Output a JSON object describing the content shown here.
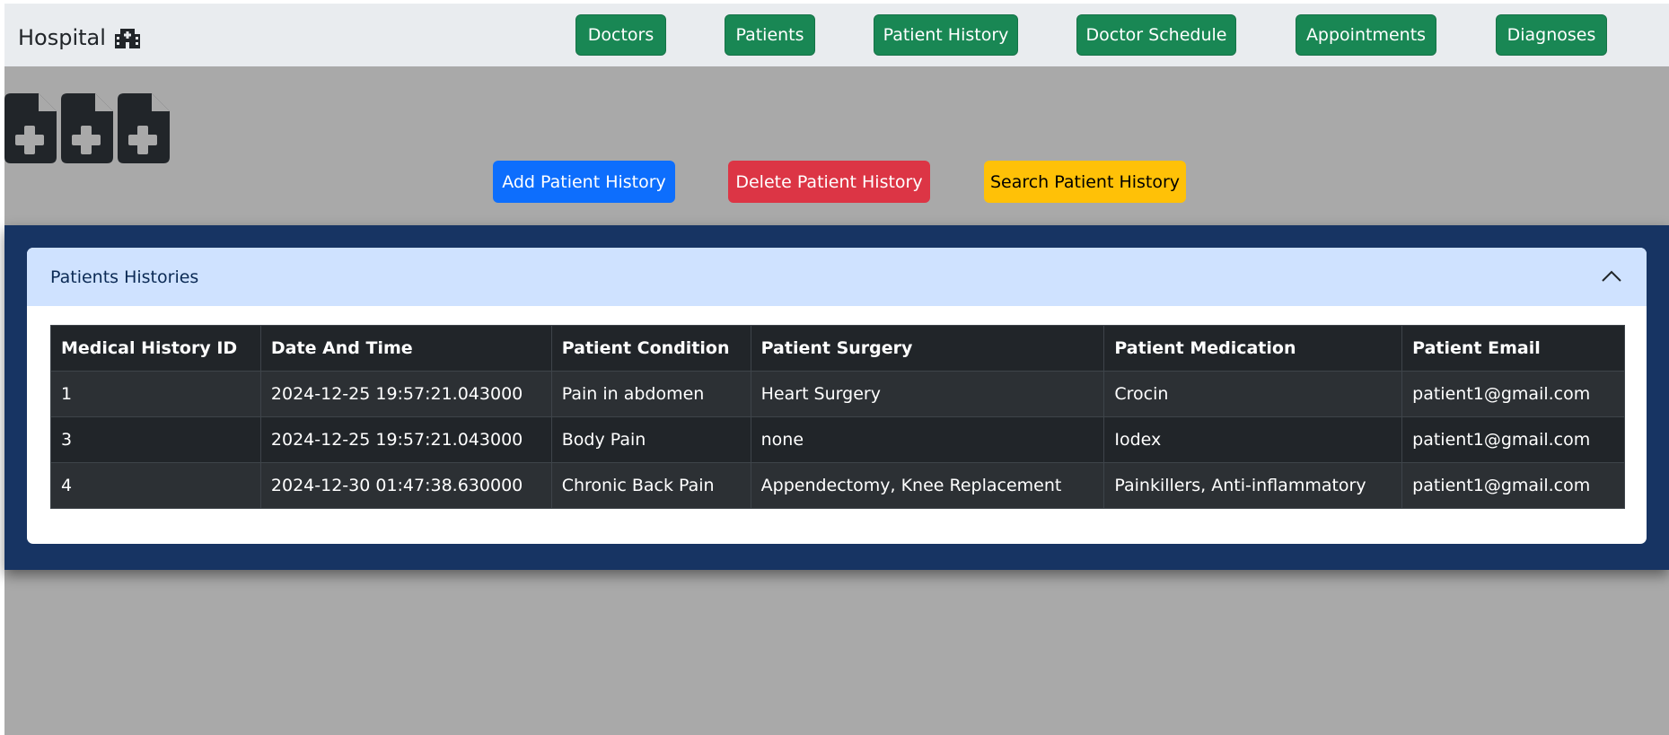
{
  "brand": {
    "title": "Hospital"
  },
  "nav": [
    {
      "label": "Doctors"
    },
    {
      "label": "Patients"
    },
    {
      "label": "Patient History"
    },
    {
      "label": "Doctor Schedule"
    },
    {
      "label": "Appointments"
    },
    {
      "label": "Diagnoses"
    }
  ],
  "actions": {
    "add": "Add Patient History",
    "delete": "Delete Patient History",
    "search": "Search Patient History"
  },
  "card": {
    "title": "Patients Histories"
  },
  "table": {
    "headers": [
      "Medical History ID",
      "Date And Time",
      "Patient Condition",
      "Patient Surgery",
      "Patient Medication",
      "Patient Email"
    ],
    "rows": [
      [
        "1",
        "2024-12-25 19:57:21.043000",
        "Pain in abdomen",
        "Heart Surgery",
        "Crocin",
        "patient1@gmail.com"
      ],
      [
        "3",
        "2024-12-25 19:57:21.043000",
        "Body Pain",
        "none",
        "Iodex",
        "patient1@gmail.com"
      ],
      [
        "4",
        "2024-12-30 01:47:38.630000",
        "Chronic Back Pain",
        "Appendectomy, Knee Replacement",
        "Painkillers, Anti-inflammatory",
        "patient1@gmail.com"
      ]
    ]
  },
  "colors": {
    "nav_button": "#198754",
    "add_button": "#0d6efd",
    "delete_button": "#dc3545",
    "search_button": "#ffc107",
    "panel": "#173463",
    "card_header": "#cfe2ff",
    "table_dark": "#212529"
  },
  "icons": [
    "hospital-icon",
    "medical-file-icon",
    "chevron-up-icon"
  ]
}
